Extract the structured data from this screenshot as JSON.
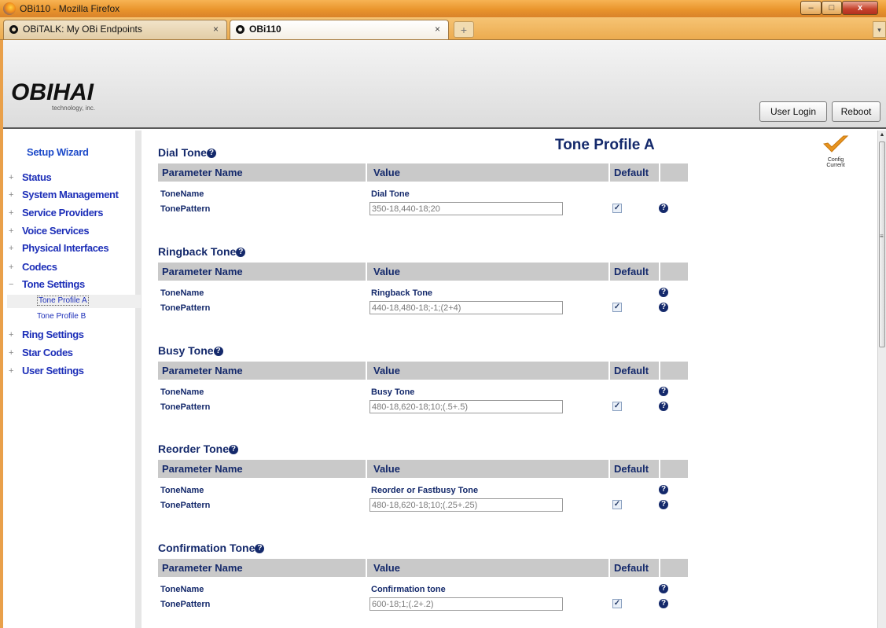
{
  "window": {
    "title": "OBi110 - Mozilla Firefox"
  },
  "tabs": [
    {
      "label": "OBiTALK: My OBi Endpoints",
      "close": "×"
    },
    {
      "label": "OBi110",
      "close": "×"
    }
  ],
  "new_tab": "+",
  "header": {
    "logo": "OBIHAI",
    "logo_sub": "technology, inc.",
    "user_login": "User Login",
    "reboot": "Reboot"
  },
  "sidebar": {
    "wizard": "Setup Wizard",
    "items": [
      {
        "label": "Status",
        "sign": "+"
      },
      {
        "label": "System Management",
        "sign": "+"
      },
      {
        "label": "Service Providers",
        "sign": "+"
      },
      {
        "label": "Voice Services",
        "sign": "+"
      },
      {
        "label": "Physical Interfaces",
        "sign": "+"
      },
      {
        "label": "Codecs",
        "sign": "+"
      },
      {
        "label": "Tone Settings",
        "sign": "−"
      },
      {
        "label": "Ring Settings",
        "sign": "+"
      },
      {
        "label": "Star Codes",
        "sign": "+"
      },
      {
        "label": "User Settings",
        "sign": "+"
      }
    ],
    "subitems": [
      "Tone Profile A",
      "Tone Profile B"
    ]
  },
  "page": {
    "title": "Tone Profile A",
    "config_line1": "Config",
    "config_line2": "Current"
  },
  "table_headers": {
    "param": "Parameter Name",
    "value": "Value",
    "default": "Default"
  },
  "sections": [
    {
      "title": "Dial Tone",
      "tone_name_label": "ToneName",
      "tone_name": "Dial Tone",
      "pattern_label": "TonePattern",
      "pattern": "350-18,440-18;20",
      "name_help": false
    },
    {
      "title": "Ringback Tone",
      "tone_name_label": "ToneName",
      "tone_name": "Ringback Tone",
      "pattern_label": "TonePattern",
      "pattern": "440-18,480-18;-1;(2+4)",
      "name_help": true
    },
    {
      "title": "Busy Tone",
      "tone_name_label": "ToneName",
      "tone_name": "Busy Tone",
      "pattern_label": "TonePattern",
      "pattern": "480-18,620-18;10;(.5+.5)",
      "name_help": true
    },
    {
      "title": "Reorder Tone",
      "tone_name_label": "ToneName",
      "tone_name": "Reorder or Fastbusy Tone",
      "pattern_label": "TonePattern",
      "pattern": "480-18,620-18;10;(.25+.25)",
      "name_help": true
    },
    {
      "title": "Confirmation Tone",
      "tone_name_label": "ToneName",
      "tone_name": "Confirmation tone",
      "pattern_label": "TonePattern",
      "pattern": "600-18;1;(.2+.2)",
      "name_help": true
    }
  ],
  "icons": {
    "help": "help-icon",
    "checkbox": "checked-checkbox",
    "config": "checkmark-icon"
  },
  "colors": {
    "title_blue": "#14296b",
    "nav_blue": "#1d2fb8",
    "header_gray": "#c9c9c9",
    "firefox_orange": "#e9952c"
  }
}
